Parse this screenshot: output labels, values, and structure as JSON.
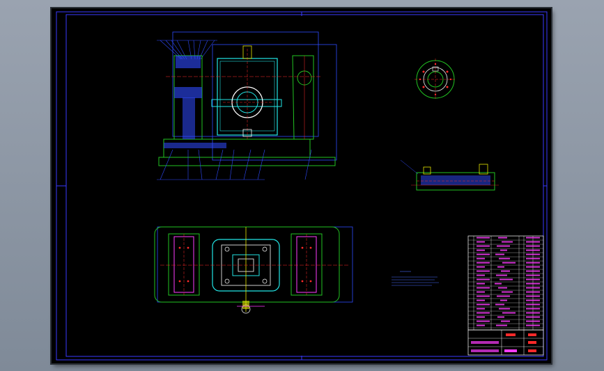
{
  "viewer": {
    "background_color": "#8c96a4",
    "sheet_color": "#000000"
  },
  "drawing": {
    "frame_color": "#3a3aff",
    "colors": {
      "cyan": "#22e5e5",
      "blue": "#2f4bff",
      "green": "#22c322",
      "magenta": "#ff3cff",
      "red": "#ff2a2a",
      "yellow": "#e6e600",
      "white": "#ffffff"
    }
  }
}
